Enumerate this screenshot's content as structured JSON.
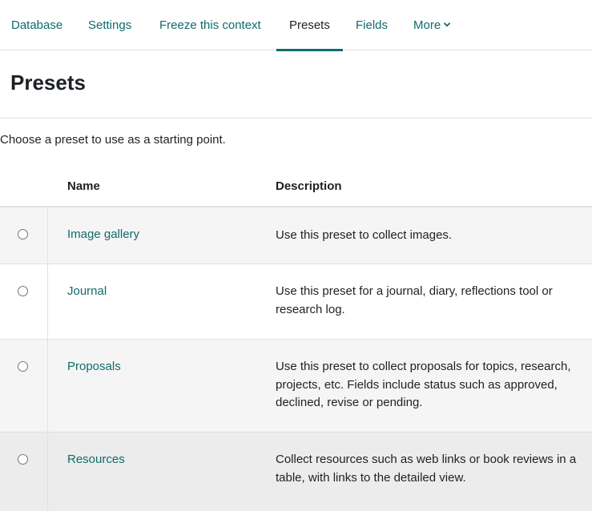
{
  "nav": {
    "tabs": [
      {
        "label": "Database"
      },
      {
        "label": "Settings"
      },
      {
        "label": "Freeze this context"
      },
      {
        "label": "Presets",
        "active": true
      },
      {
        "label": "Fields"
      },
      {
        "label": "More"
      }
    ]
  },
  "page": {
    "title": "Presets",
    "intro": "Choose a preset to use as a starting point."
  },
  "table": {
    "columns": [
      "Name",
      "Description"
    ],
    "rows": [
      {
        "name": "Image gallery",
        "description": "Use this preset to collect images."
      },
      {
        "name": "Journal",
        "description": "Use this preset for a journal, diary, reflections tool or research log."
      },
      {
        "name": "Proposals",
        "description": "Use this preset to collect proposals for topics, research, projects, etc. Fields include status such as approved, declined, revise or pending."
      },
      {
        "name": "Resources",
        "description": "Collect resources such as web links or book reviews in a table, with links to the detailed view."
      }
    ]
  },
  "colors": {
    "link": "#0f6c6b",
    "active_underline": "#0f6c6b",
    "text": "#1d2125",
    "row_stripe": "#f5f5f5"
  },
  "icons": {
    "more_dropdown": "chevron-down-icon",
    "row_select": "radio-button"
  }
}
